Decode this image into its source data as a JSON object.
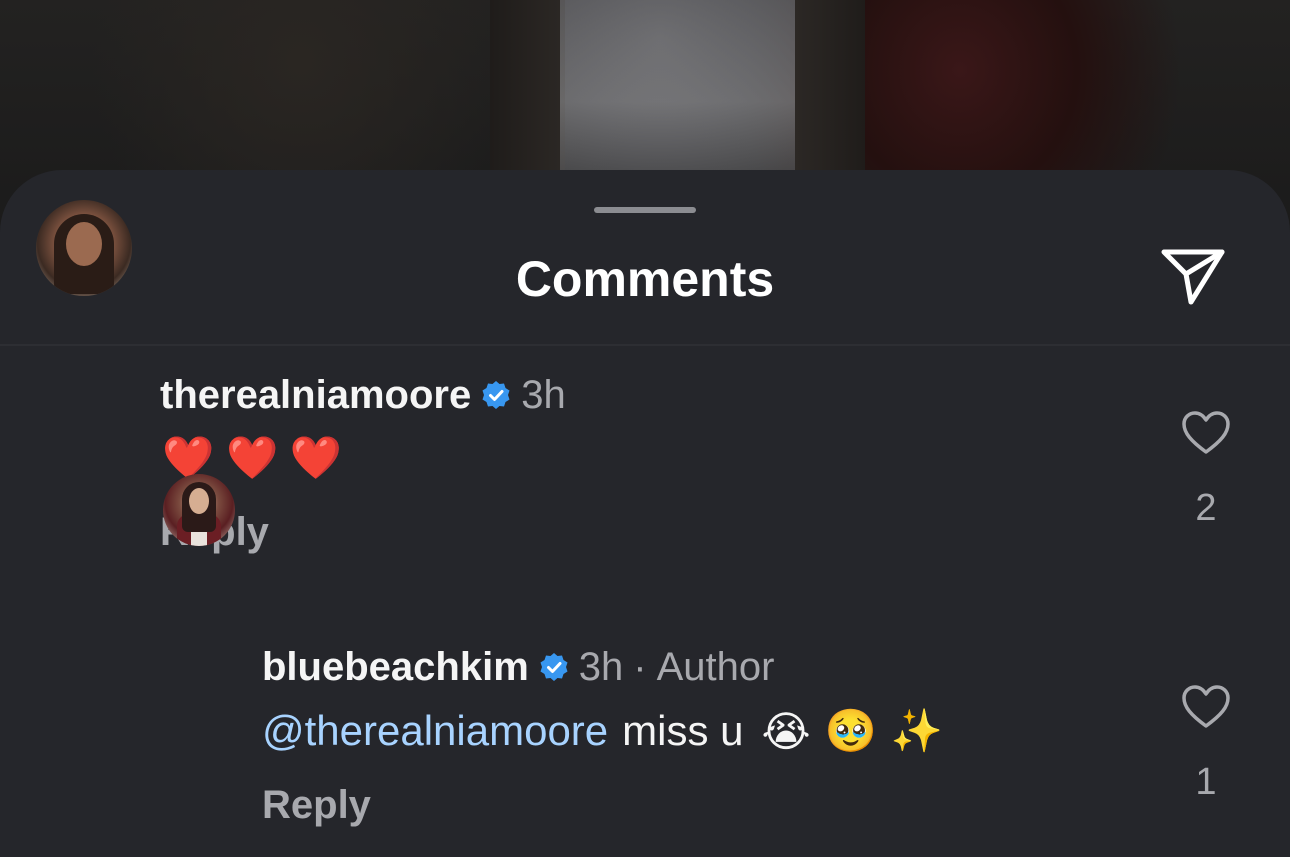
{
  "sheet": {
    "title": "Comments",
    "share_icon": "paper-plane-icon"
  },
  "comments": [
    {
      "username": "therealniamoore",
      "verified": true,
      "time": "3h",
      "text": "❤️ ❤️ ❤️",
      "reply_label": "Reply",
      "like_count": "2"
    }
  ],
  "replies": [
    {
      "username": "bluebeachkim",
      "verified": true,
      "time": "3h",
      "separator": "·",
      "author_label": "Author",
      "mention": "@therealniamoore",
      "text": "miss u",
      "emojis": [
        "😭",
        "🥹",
        "✨"
      ],
      "reply_label": "Reply",
      "like_count": "1"
    }
  ],
  "colors": {
    "sheet_bg": "#25262b",
    "verified_blue": "#3897f0",
    "mention_blue": "#a8d3ff",
    "muted_text": "#a8a9ae"
  }
}
